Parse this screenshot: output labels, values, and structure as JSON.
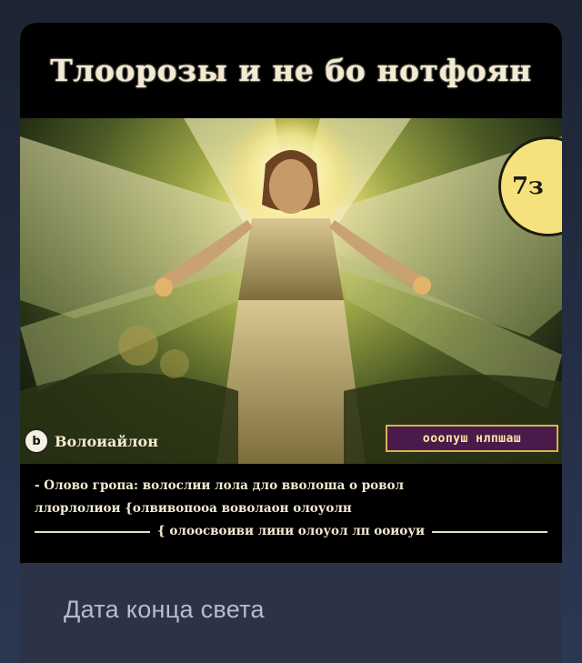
{
  "post": {
    "image": {
      "title": "Тлоорозы и не бо нотфоян",
      "badge_number": "7з",
      "left_tag": "Волоиайлон",
      "left_tag_icon": "b",
      "right_tag": "ооопуш нлпшаш",
      "caption_lines": [
        "- Олово гропа: волослии лола дло вволоша о ровол",
        "ллорлолиои {олвивопооа воволаон олоуолн",
        "{ олоосвоиви лини олоуол лп ооиоуи"
      ],
      "caption_highlight": "лп ооиоуи"
    },
    "caption": "Дата конца света"
  }
}
